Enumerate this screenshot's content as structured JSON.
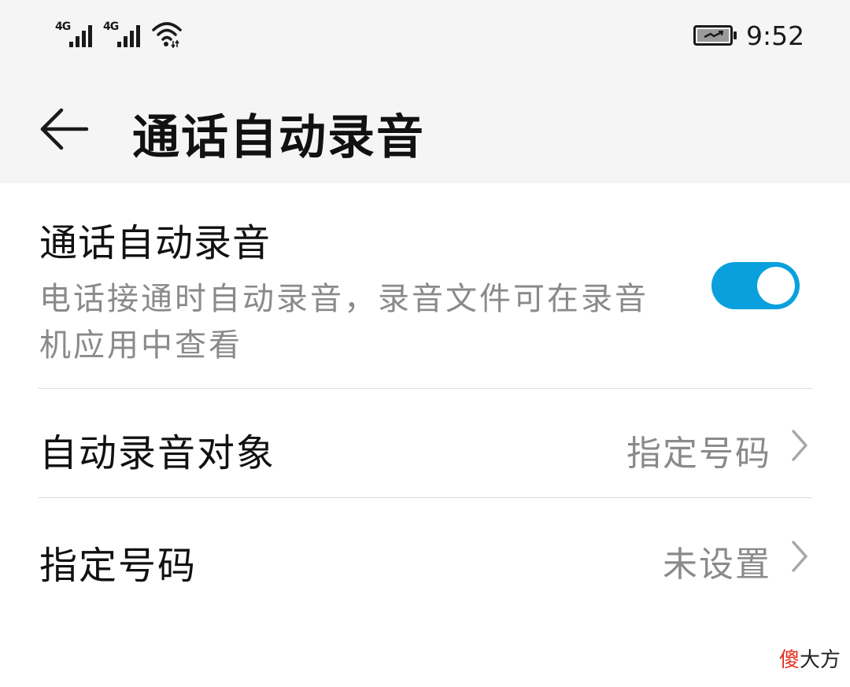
{
  "status_bar": {
    "sim1_tag": "4G",
    "sim2_tag": "4G",
    "time": "9:52"
  },
  "app_bar": {
    "title": "通话自动录音"
  },
  "settings": {
    "auto_record": {
      "title": "通话自动录音",
      "subtitle": "电话接通时自动录音，录音文件可在录音机应用中查看",
      "enabled": true
    },
    "record_target": {
      "label": "自动录音对象",
      "value": "指定号码"
    },
    "specified_numbers": {
      "label": "指定号码",
      "value": "未设置"
    }
  },
  "watermark": {
    "first_char": "傻",
    "rest": "大方"
  },
  "colors": {
    "toggle_on": "#0aa0de",
    "header_bg": "#f5f5f5",
    "secondary_text": "#8a8a8a"
  },
  "icons": [
    "signal-icon",
    "wifi-icon",
    "battery-charging-icon",
    "back-arrow-icon",
    "chevron-right-icon"
  ]
}
